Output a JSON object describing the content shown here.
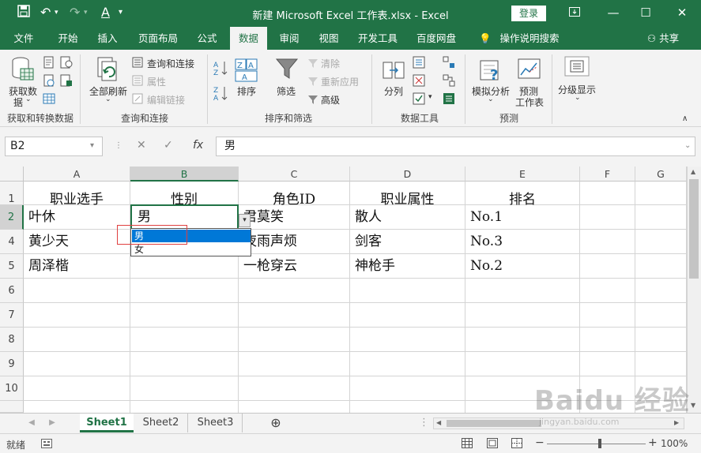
{
  "titlebar": {
    "title": "新建 Microsoft Excel 工作表.xlsx  -  Excel",
    "login": "登录",
    "save_icon": "save-icon",
    "undo_icon": "undo-icon",
    "redo_icon": "redo-icon",
    "font_color_icon": "font-color-icon"
  },
  "tabs": [
    "文件",
    "开始",
    "插入",
    "页面布局",
    "公式",
    "数据",
    "审阅",
    "视图",
    "开发工具",
    "百度网盘"
  ],
  "active_tab": "数据",
  "tell_me": "操作说明搜索",
  "share": "共享",
  "ribbon": {
    "get_data": "获取数",
    "get_data2": "据",
    "group_get": "获取和转换数据",
    "refresh_all": "全部刷新",
    "queries": "查询和连接",
    "properties": "属性",
    "edit_links": "编辑链接",
    "group_queries": "查询和连接",
    "sort": "排序",
    "filter": "筛选",
    "clear": "清除",
    "reapply": "重新应用",
    "advanced": "高级",
    "group_sort": "排序和筛选",
    "split": "分列",
    "group_tools": "数据工具",
    "what_if": "模拟分析",
    "forecast": "预测",
    "forecast_sheet": "工作表",
    "group_forecast": "预测",
    "outline": "分级显示"
  },
  "formula_bar": {
    "name_box": "B2",
    "formula": "男",
    "fx": "fx"
  },
  "columns": [
    "A",
    "B",
    "C",
    "D",
    "E",
    "F",
    "G"
  ],
  "rows": [
    {
      "num": "1",
      "cells": [
        "职业选手",
        "性别",
        "角色ID",
        "职业属性",
        "排名",
        "",
        ""
      ]
    },
    {
      "num": "2",
      "cells": [
        "叶休",
        "男",
        "君莫笑",
        "散人",
        "No.1",
        "",
        ""
      ]
    },
    {
      "num": "4",
      "cells": [
        "黄少天",
        "",
        "夜雨声烦",
        "剑客",
        "No.3",
        "",
        ""
      ]
    },
    {
      "num": "5",
      "cells": [
        "周泽楷",
        "",
        "一枪穿云",
        "神枪手",
        "No.2",
        "",
        ""
      ]
    },
    {
      "num": "6",
      "cells": [
        "",
        "",
        "",
        "",
        "",
        "",
        ""
      ]
    },
    {
      "num": "7",
      "cells": [
        "",
        "",
        "",
        "",
        "",
        "",
        ""
      ]
    },
    {
      "num": "8",
      "cells": [
        "",
        "",
        "",
        "",
        "",
        "",
        ""
      ]
    },
    {
      "num": "9",
      "cells": [
        "",
        "",
        "",
        "",
        "",
        "",
        ""
      ]
    },
    {
      "num": "10",
      "cells": [
        "",
        "",
        "",
        "",
        "",
        "",
        ""
      ]
    }
  ],
  "dropdown": {
    "options": [
      "男",
      "女"
    ],
    "selected": "男"
  },
  "sheets": [
    "Sheet1",
    "Sheet2",
    "Sheet3"
  ],
  "active_sheet": "Sheet1",
  "status": {
    "ready": "就绪",
    "zoom": "100%",
    "watermark": "Baidu 经验",
    "watermark_url": "jingyan.baidu.com"
  }
}
